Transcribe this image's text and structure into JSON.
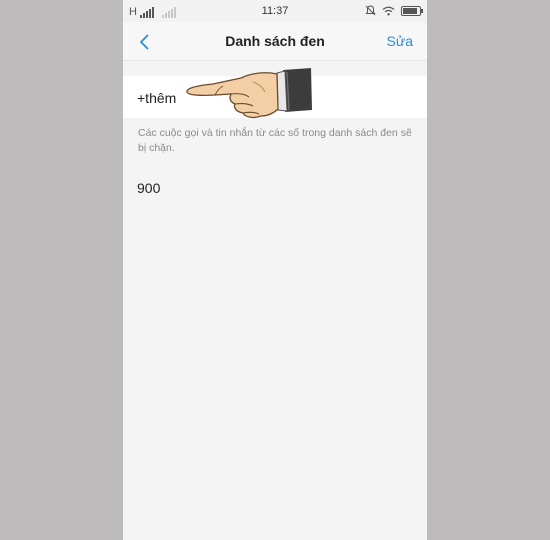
{
  "status_bar": {
    "network": "H",
    "time": "11:37",
    "battery_level": 0.85,
    "icons": [
      "signal-icon",
      "signal-secondary-icon",
      "mute-alarm-icon",
      "wifi-icon",
      "battery-icon"
    ]
  },
  "header": {
    "back_icon": "chevron-left-icon",
    "title": "Danh sách đen",
    "edit_label": "Sửa"
  },
  "blacklist": {
    "add_label": "+thêm",
    "hint": "Các cuộc gọi và tin nhắn từ các số trong danh sách đen sẽ bị chặn.",
    "numbers": [
      "900"
    ]
  },
  "overlay": {
    "icon": "pointing-hand-icon"
  },
  "colors": {
    "accent": "#2e8bd8",
    "background": "#bdbbbc",
    "screen": "#f4f4f4"
  }
}
